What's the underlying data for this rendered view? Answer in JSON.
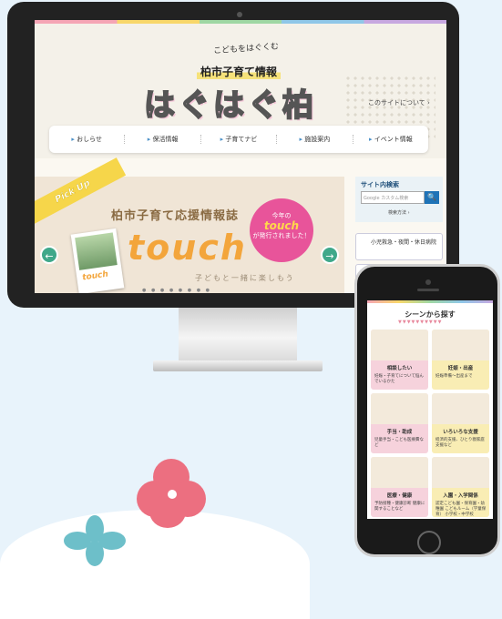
{
  "colors": {
    "accent_green": "#3fa88a",
    "accent_pink": "#e8549a",
    "accent_yellow": "#f6d64a",
    "search_blue": "#1f73b7",
    "tile_pink": "#f6d2dc",
    "tile_yellow": "#f9edb4"
  },
  "desktop": {
    "header": {
      "tagline": "こどもをはぐくむ",
      "subtitle": "柏市子育て情報",
      "logo": "はぐはぐ柏",
      "about_link": "このサイトについて ›"
    },
    "nav": [
      "おしらせ",
      "保活情報",
      "子育てナビ",
      "施設案内",
      "イベント情報"
    ],
    "pickup": {
      "ribbon": "Pick Up",
      "title": "柏市子育て応援情報誌",
      "word": "touch",
      "sub": "子どもと一緒に楽しもう",
      "badge_line1": "今年の",
      "badge_word": "touch",
      "badge_line2": "が発行されました！",
      "mag_label": "touch",
      "prev": "←",
      "next": "→"
    },
    "sidebar": {
      "search_title": "サイト内検索",
      "search_placeholder": "Google カスタム検索",
      "search_btn": "🔍",
      "search_help": "検索方法 ›",
      "card1": "小児救急・夜間・休日病院"
    }
  },
  "phone": {
    "title": "シーンから探す",
    "tiles": [
      {
        "title": "相談したい",
        "desc": "妊娠・子育てについて悩んでいるかた",
        "color": "pink"
      },
      {
        "title": "妊娠・出産",
        "desc": "妊娠準備〜出産まで",
        "color": "yellow"
      },
      {
        "title": "手当・助成",
        "desc": "児童手当・こども医療費など",
        "color": "pink"
      },
      {
        "title": "いろいろな支援",
        "desc": "経済的支援、ひとり親家庭支援など",
        "color": "yellow"
      },
      {
        "title": "医療・健康",
        "desc": "予防接種・健康診断 健康に関することなど",
        "color": "pink"
      },
      {
        "title": "入園・入学関係",
        "desc": "認定こども園・保育園・幼稚園 こどもルーム（学童保育） 小学校・中学校",
        "color": "yellow"
      }
    ]
  }
}
